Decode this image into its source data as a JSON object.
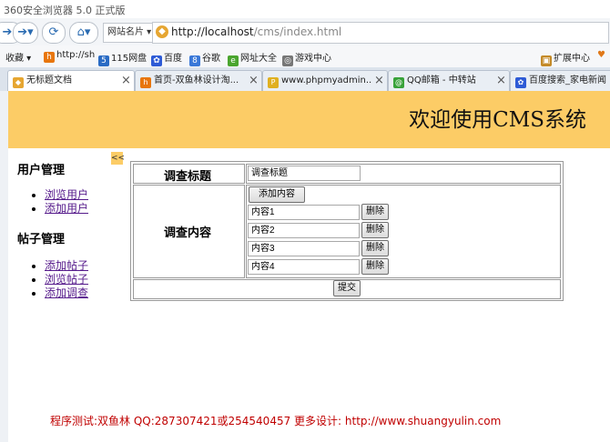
{
  "browser": {
    "window_title": "360安全浏览器 5.0 正式版",
    "site_name_button": "网站名片",
    "address_url_host": "http://localhost",
    "address_url_path": "/cms/index.html",
    "favorites": {
      "label": "收藏",
      "items": [
        "http://sh",
        "115网盘",
        "百度",
        "谷歌",
        "网址大全",
        "游戏中心"
      ],
      "extensions": "扩展中心"
    },
    "tabs": [
      {
        "label": "无标题文档",
        "active": true
      },
      {
        "label": "首页-双鱼林设计淘...",
        "active": false
      },
      {
        "label": "www.phpmyadmin....",
        "active": false
      },
      {
        "label": "QQ邮箱 - 中转站",
        "active": false
      },
      {
        "label": "百度搜索_家电新闻",
        "active": false
      }
    ]
  },
  "page": {
    "header_title": "欢迎使用CMS系统",
    "collapse_toggle": "<<",
    "sidebar": {
      "sections": [
        {
          "heading": "用户管理",
          "links": [
            "浏览用户",
            "添加用户"
          ]
        },
        {
          "heading": "帖子管理",
          "links": [
            "添加帖子",
            "浏览帖子",
            "添加调查"
          ]
        }
      ]
    },
    "form": {
      "title_label": "调查标题",
      "title_value": "调查标题",
      "content_label": "调查内容",
      "add_content_button": "添加内容",
      "items": [
        {
          "value": "内容1",
          "delete_label": "删除"
        },
        {
          "value": "内容2",
          "delete_label": "删除"
        },
        {
          "value": "内容3",
          "delete_label": "删除"
        },
        {
          "value": "内容4",
          "delete_label": "删除"
        }
      ],
      "submit_button": "提交"
    },
    "footer": "程序测试:双鱼林 QQ:287307421或254540457 更多设计: http://www.shuangyulin.com"
  }
}
